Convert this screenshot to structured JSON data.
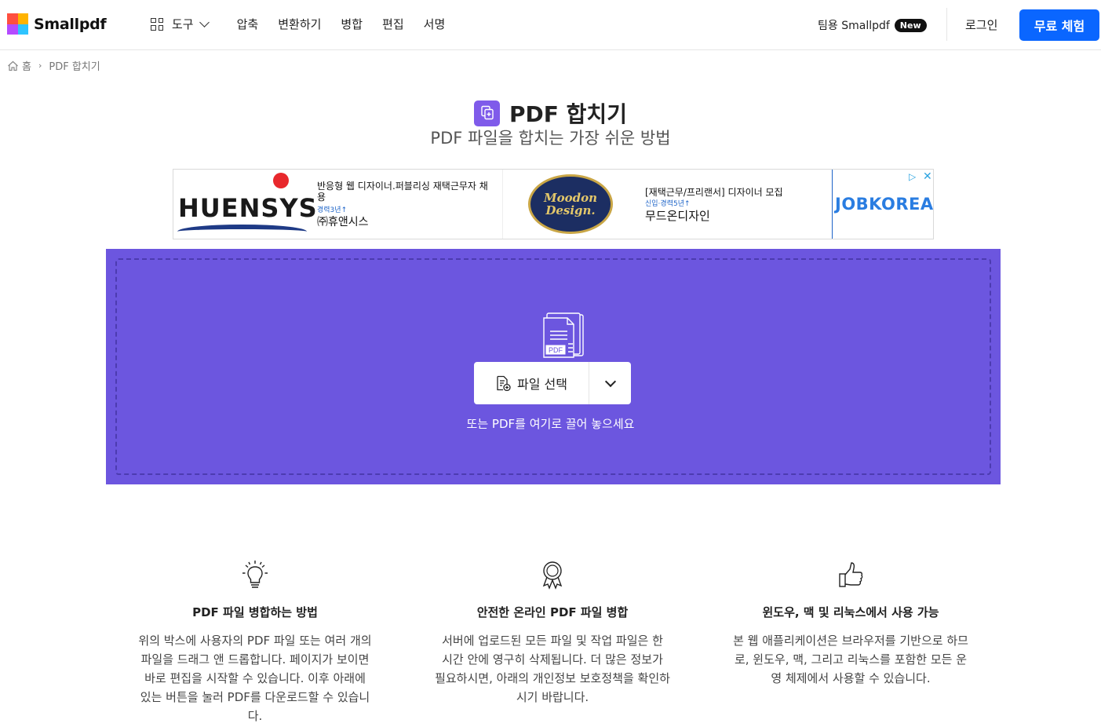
{
  "header": {
    "logo_text": "Smallpdf",
    "nav": {
      "tools_label": "도구",
      "items": [
        "압축",
        "변환하기",
        "병합",
        "편집",
        "서명"
      ]
    },
    "team_label": "팀용 Smallpdf",
    "team_badge": "New",
    "login_label": "로그인",
    "trial_label": "무료 체험"
  },
  "breadcrumb": {
    "home": "홈",
    "current": "PDF 합치기"
  },
  "hero": {
    "title": "PDF 합치기",
    "subtitle": "PDF 파일을 합치는 가장 쉬운 방법"
  },
  "ad": {
    "brand1": "HUENSYS",
    "text1": "반응형 웹 디자이너.퍼블리싱 재택근무자 채용",
    "text1_sub": "경력3년↑",
    "text1_company": "㈜휴앤시스",
    "brand2_line1": "Moodon",
    "brand2_line2": "Design.",
    "text2": "[재택근무/프리랜서] 디자이너 모집",
    "text2_sub": "신입·경력5년↑",
    "text2_company": "무드온디자인",
    "brand3": "JOBKOREA",
    "adchoice_icon": "ad-choice-icon",
    "close_icon": "close-icon"
  },
  "dropzone": {
    "file_type_label": "PDF",
    "select_label": "파일 선택",
    "hint": "또는 PDF를 여기로 끌어 놓으세요",
    "background": "#6c56df"
  },
  "features": [
    {
      "icon": "lightbulb-icon",
      "title": "PDF 파일 병합하는 방법",
      "text": "위의 박스에 사용자의 PDF 파일 또는 여러 개의 파일을 드래그 앤 드롭합니다. 페이지가 보이면 바로 편집을 시작할 수 있습니다. 이후 아래에 있는 버튼을 눌러 PDF를 다운로드할 수 있습니다."
    },
    {
      "icon": "award-icon",
      "title": "안전한 온라인 PDF 파일 병합",
      "text": "서버에 업로드된 모든 파일 및 작업 파일은 한 시간 안에 영구히 삭제됩니다. 더 많은 정보가 필요하시면, 아래의 개인정보 보호정책을 확인하시기 바랍니다."
    },
    {
      "icon": "thumbs-up-icon",
      "title": "윈도우, 맥 및 리눅스에서 사용 가능",
      "text": "본 웹 애플리케이션은 브라우저를 기반으로 하므로, 윈도우, 맥, 그리고 리눅스를 포함한 모든 운영 체제에서 사용할 수 있습니다."
    }
  ],
  "colors": {
    "accent": "#0a66ff",
    "tool": "#7f5bea"
  }
}
